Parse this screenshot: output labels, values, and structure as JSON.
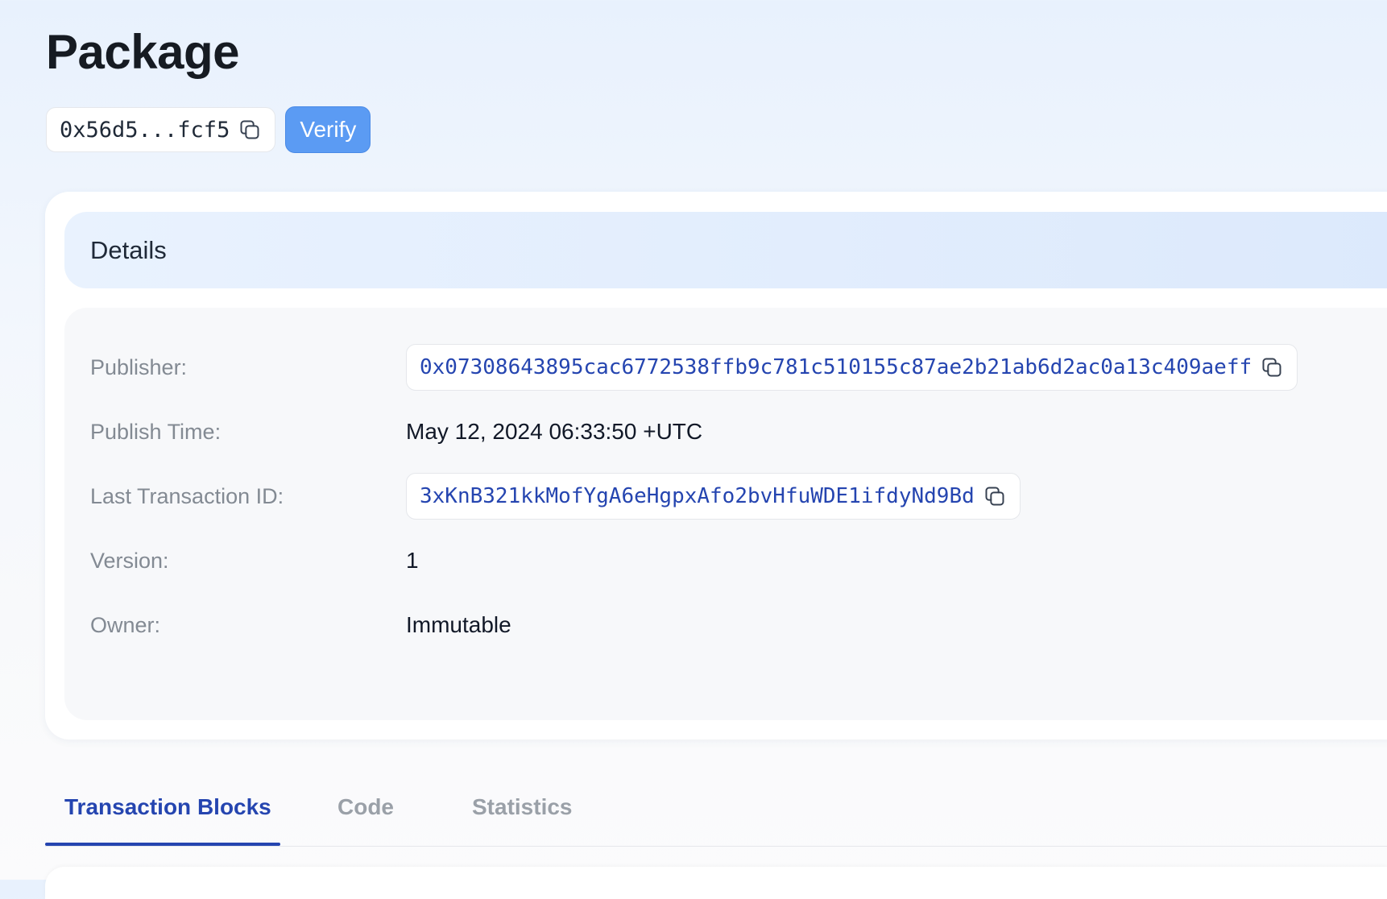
{
  "page": {
    "title": "Package"
  },
  "package": {
    "short_id": "0x56d5...fcf5",
    "verify_label": "Verify"
  },
  "details": {
    "title": "Details",
    "rows": [
      {
        "label": "Publisher:",
        "value": "0x07308643895cac6772538ffb9c781c510155c87ae2b21ab6d2ac0a13c409aeff",
        "kind": "link-copy"
      },
      {
        "label": "Publish Time:",
        "value": "May 12, 2024 06:33:50 +UTC",
        "kind": "text"
      },
      {
        "label": "Last Transaction ID:",
        "value": "3xKnB321kkMofYgA6eHgpxAfo2bvHfuWDE1ifdyNd9Bd",
        "kind": "link-copy"
      },
      {
        "label": "Version:",
        "value": "1",
        "kind": "text"
      },
      {
        "label": "Owner:",
        "value": "Immutable",
        "kind": "text"
      }
    ]
  },
  "tabs": [
    {
      "label": "Transaction Blocks",
      "active": true
    },
    {
      "label": "Code",
      "active": false
    },
    {
      "label": "Statistics",
      "active": false
    }
  ],
  "colors": {
    "accent": "#2545b0",
    "verify": "#5b9bf3",
    "label": "#838a93"
  },
  "icons": {
    "copy": "copy-icon"
  }
}
